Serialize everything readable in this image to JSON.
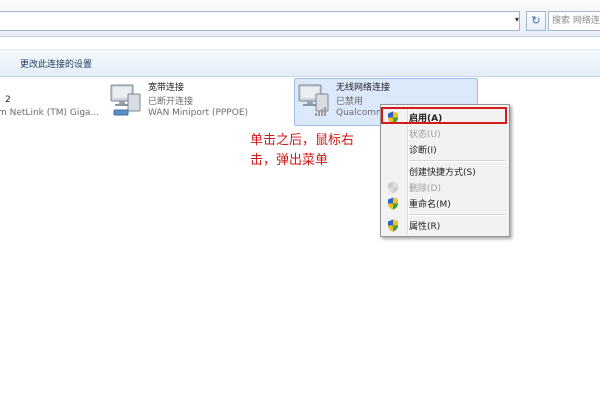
{
  "address_bar": {
    "dropdown_glyph": "▾",
    "refresh_glyph": "↻",
    "search_placeholder": "搜索 网络连接"
  },
  "toolbar": {
    "change_settings": "更改此连接的设置"
  },
  "connections": [
    {
      "name": "",
      "status": "2",
      "device": "m NetLink (TM) Giga..."
    },
    {
      "name": "宽带连接",
      "status": "已断开连接",
      "device": "WAN Miniport (PPPOE)"
    },
    {
      "name": "无线网络连接",
      "status": "已禁用",
      "device": "Qualcomm"
    }
  ],
  "annotation": {
    "line1": "单击之后，鼠标右",
    "line2": "击，弹出菜单"
  },
  "context_menu": {
    "items": [
      {
        "label": "启用(A)",
        "enabled": true,
        "icon": "shield-icon"
      },
      {
        "label": "状态(U)",
        "enabled": false,
        "icon": ""
      },
      {
        "label": "诊断(I)",
        "enabled": true,
        "icon": ""
      },
      {
        "label": "创建快捷方式(S)",
        "enabled": true,
        "icon": ""
      },
      {
        "label": "删除(D)",
        "enabled": false,
        "icon": "shield-icon"
      },
      {
        "label": "重命名(M)",
        "enabled": true,
        "icon": "shield-icon"
      },
      {
        "label": "属性(R)",
        "enabled": true,
        "icon": "shield-icon"
      }
    ]
  },
  "colors": {
    "annotation_red": "#d01818",
    "highlight_red": "#d41c1c",
    "selection_blue": "#dce9fa"
  }
}
